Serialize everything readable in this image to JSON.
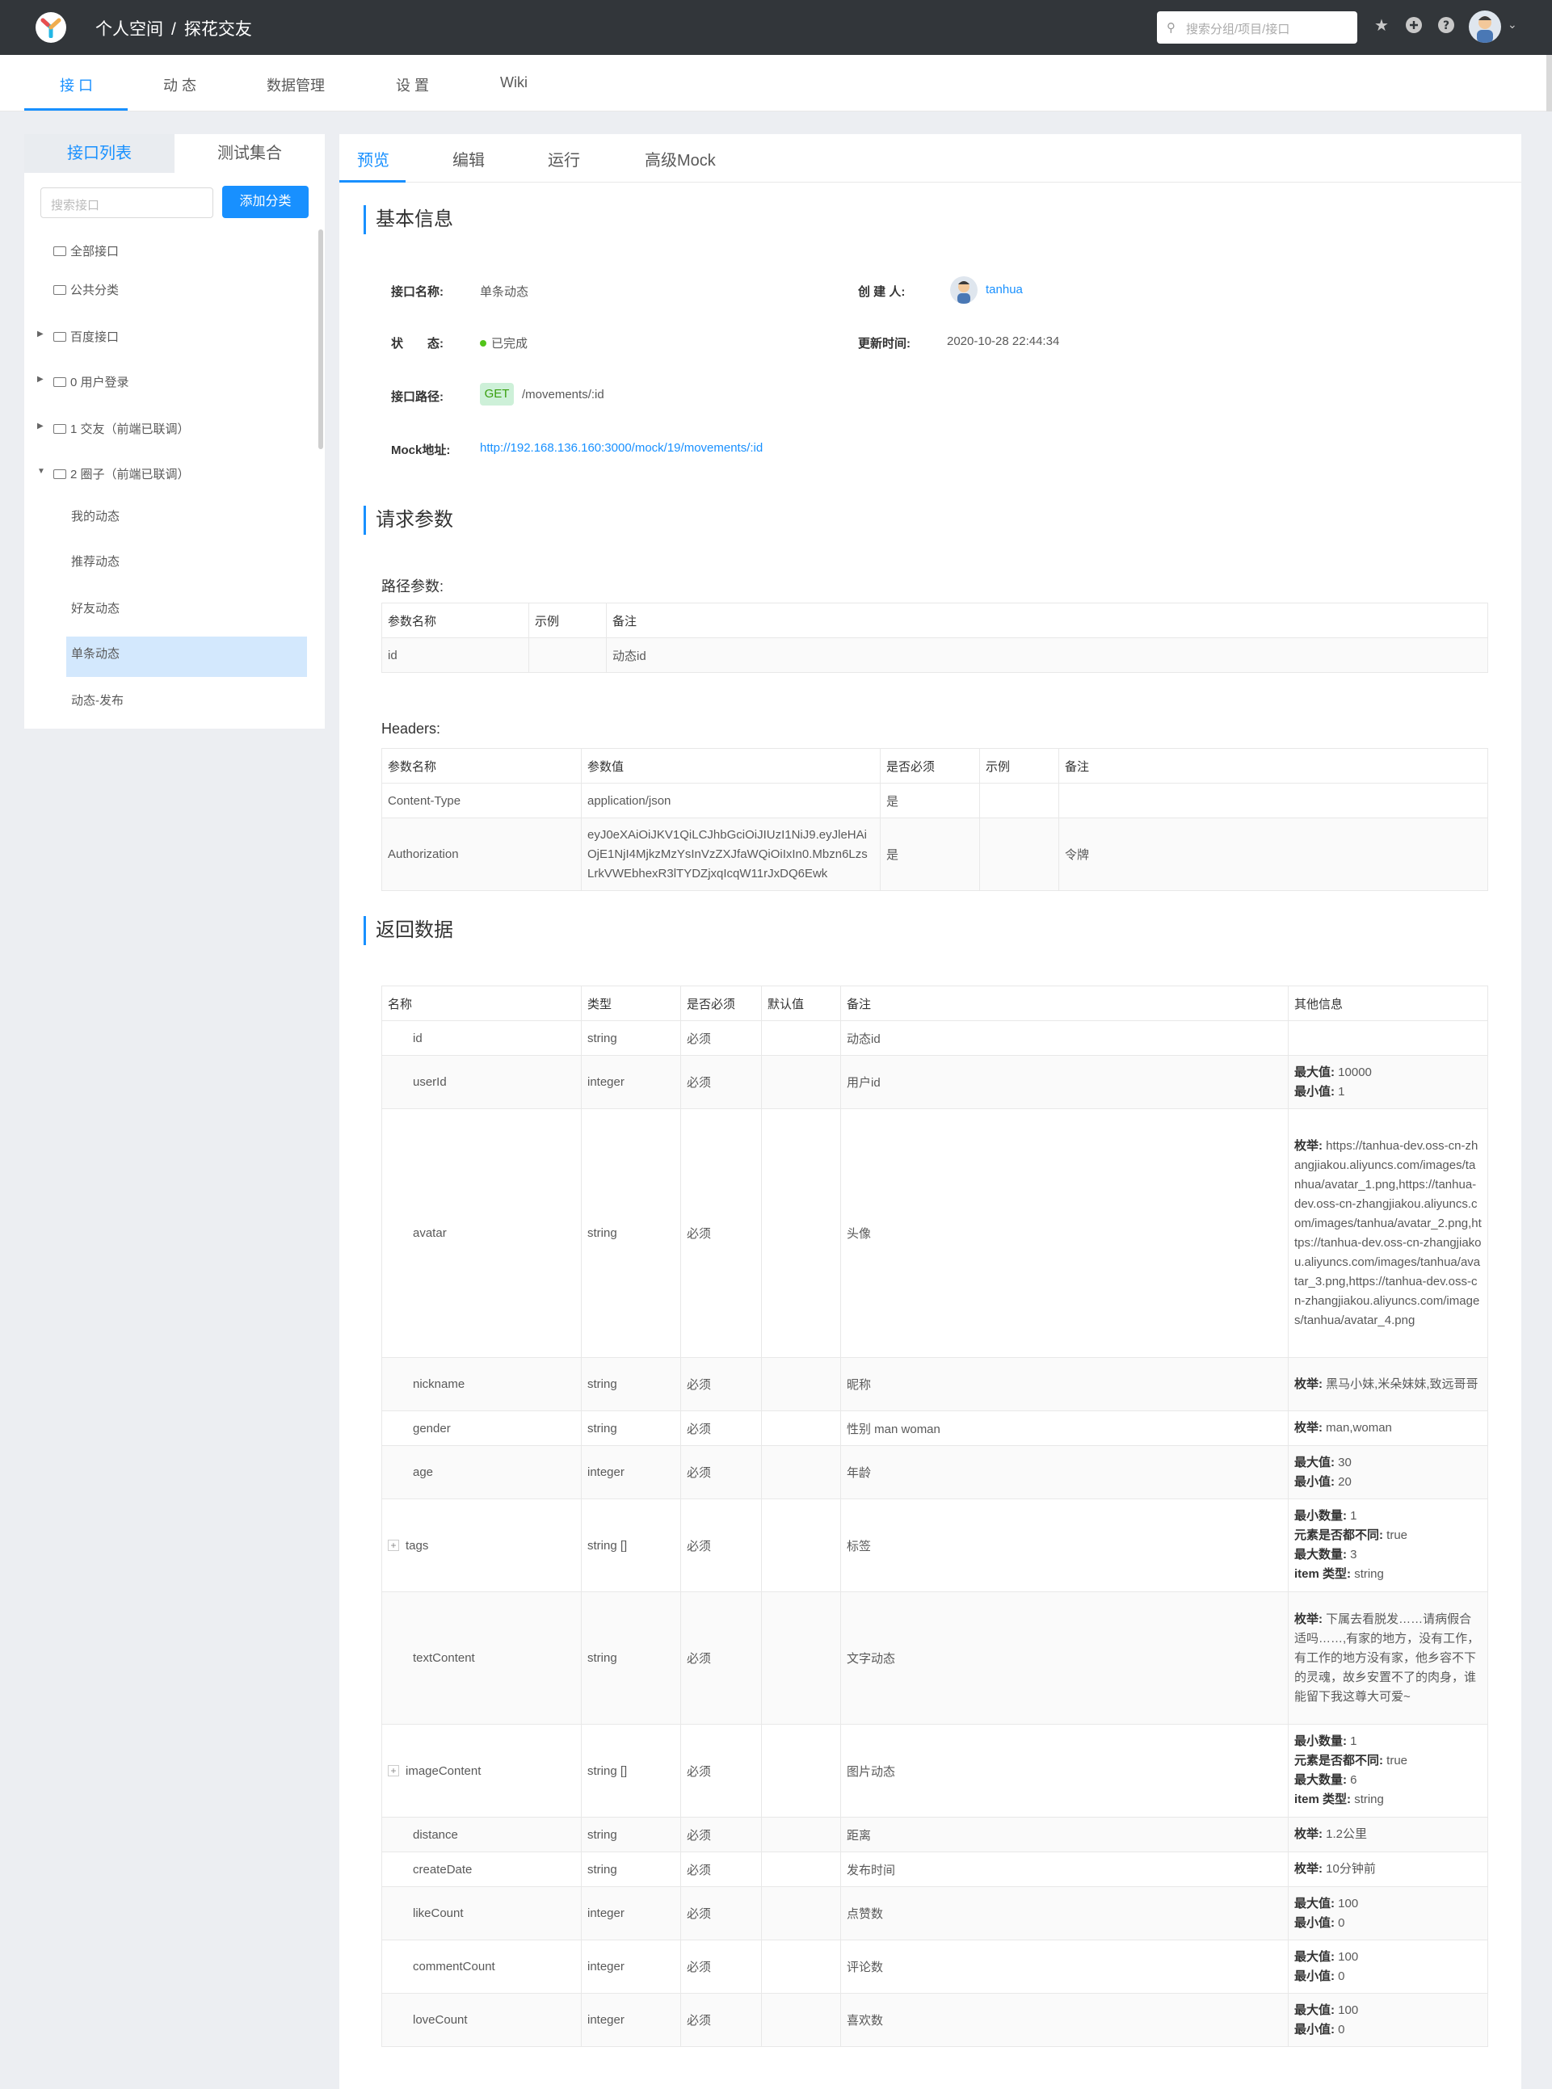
{
  "header": {
    "crumb_space": "个人空间",
    "crumb_sep": "/",
    "crumb_project": "探花交友",
    "search_placeholder": "搜索分组/项目/接口"
  },
  "subnav": [
    "接 口",
    "动 态",
    "数据管理",
    "设 置",
    "Wiki"
  ],
  "left": {
    "tab_list": "接口列表",
    "tab_test": "测试集合",
    "search_placeholder": "搜索接口",
    "add_button": "添加分类",
    "nodes": [
      "全部接口",
      "公共分类",
      "百度接口",
      "0 用户登录",
      "1 交友（前端已联调）",
      "2 圈子（前端已联调）"
    ],
    "children": [
      "我的动态",
      "推荐动态",
      "好友动态",
      "单条动态",
      "动态-发布"
    ]
  },
  "tabs": [
    "预览",
    "编辑",
    "运行",
    "高级Mock"
  ],
  "basic": {
    "title": "基本信息",
    "name_label": "接口名称:",
    "name_value": "单条动态",
    "creator_label": "创 建 人:",
    "creator_value": "tanhua",
    "status_label": "状　　态:",
    "status_value": "已完成",
    "updated_label": "更新时间:",
    "updated_value": "2020-10-28 22:44:34",
    "path_label": "接口路径:",
    "method": "GET",
    "path_value": "/movements/:id",
    "mock_label": "Mock地址:",
    "mock_value": "http://192.168.136.160:3000/mock/19/movements/:id"
  },
  "request": {
    "title": "请求参数",
    "path_params_label": "路径参数:",
    "path_headers": [
      "参数名称",
      "示例",
      "备注"
    ],
    "path_rows": [
      [
        "id",
        "",
        "动态id"
      ]
    ],
    "headers_label": "Headers:",
    "header_cols": [
      "参数名称",
      "参数值",
      "是否必须",
      "示例",
      "备注"
    ],
    "header_rows": [
      [
        "Content-Type",
        "application/json",
        "是",
        "",
        ""
      ],
      [
        "Authorization",
        "eyJ0eXAiOiJKV1QiLCJhbGciOiJIUzI1NiJ9.eyJleHAiOjE1NjI4MjkzMzYsInVzZXJfaWQiOiIxIn0.Mbzn6LzsLrkVWEbhexR3lTYDZjxqIcqW11rJxDQ6Ewk",
        "是",
        "",
        "令牌"
      ]
    ]
  },
  "response": {
    "title": "返回数据",
    "cols": [
      "名称",
      "类型",
      "是否必须",
      "默认值",
      "备注",
      "其他信息"
    ],
    "rows": [
      {
        "name": "id",
        "type": "string",
        "req": "必须",
        "def": "",
        "note": "动态id",
        "other": []
      },
      {
        "name": "userId",
        "type": "integer",
        "req": "必须",
        "def": "",
        "note": "用户id",
        "other": [
          [
            "最大值:",
            "10000"
          ],
          [
            "最小值:",
            "1"
          ]
        ]
      },
      {
        "name": "avatar",
        "type": "string",
        "req": "必须",
        "def": "",
        "note": "头像",
        "other": [
          [
            "枚举:",
            "https://tanhua-dev.oss-cn-zhangjiakou.aliyuncs.com/images/tanhua/avatar_1.png,https://tanhua-dev.oss-cn-zhangjiakou.aliyuncs.com/images/tanhua/avatar_2.png,https://tanhua-dev.oss-cn-zhangjiakou.aliyuncs.com/images/tanhua/avatar_3.png,https://tanhua-dev.oss-cn-zhangjiakou.aliyuncs.com/images/tanhua/avatar_4.png"
          ]
        ]
      },
      {
        "name": "nickname",
        "type": "string",
        "req": "必须",
        "def": "",
        "note": "昵称",
        "other": [
          [
            "枚举:",
            "黑马小妹,米朵妹妹,致远哥哥"
          ]
        ]
      },
      {
        "name": "gender",
        "type": "string",
        "req": "必须",
        "def": "",
        "note": "性别 man woman",
        "other": [
          [
            "枚举:",
            "man,woman"
          ]
        ]
      },
      {
        "name": "age",
        "type": "integer",
        "req": "必须",
        "def": "",
        "note": "年龄",
        "other": [
          [
            "最大值:",
            "30"
          ],
          [
            "最小值:",
            "20"
          ]
        ]
      },
      {
        "name": "tags",
        "type": "string []",
        "req": "必须",
        "def": "",
        "note": "标签",
        "expand": "+",
        "other": [
          [
            "最小数量:",
            "1"
          ],
          [
            "元素是否都不同:",
            "true"
          ],
          [
            "最大数量:",
            "3"
          ],
          [
            "item 类型:",
            "string"
          ]
        ]
      },
      {
        "name": "textContent",
        "type": "string",
        "req": "必须",
        "def": "",
        "note": "文字动态",
        "other": [
          [
            "枚举:",
            "下属去看脱发……请病假合适吗……,有家的地方，没有工作，有工作的地方没有家，他乡容不下的灵魂，故乡安置不了的肉身，谁能留下我这尊大可爱~"
          ]
        ]
      },
      {
        "name": "imageContent",
        "type": "string []",
        "req": "必须",
        "def": "",
        "note": "图片动态",
        "expand": "+",
        "other": [
          [
            "最小数量:",
            "1"
          ],
          [
            "元素是否都不同:",
            "true"
          ],
          [
            "最大数量:",
            "6"
          ],
          [
            "item 类型:",
            "string"
          ]
        ]
      },
      {
        "name": "distance",
        "type": "string",
        "req": "必须",
        "def": "",
        "note": "距离",
        "other": [
          [
            "枚举:",
            "1.2公里"
          ]
        ]
      },
      {
        "name": "createDate",
        "type": "string",
        "req": "必须",
        "def": "",
        "note": "发布时间",
        "other": [
          [
            "枚举:",
            "10分钟前"
          ]
        ]
      },
      {
        "name": "likeCount",
        "type": "integer",
        "req": "必须",
        "def": "",
        "note": "点赞数",
        "other": [
          [
            "最大值:",
            "100"
          ],
          [
            "最小值:",
            "0"
          ]
        ]
      },
      {
        "name": "commentCount",
        "type": "integer",
        "req": "必须",
        "def": "",
        "note": "评论数",
        "other": [
          [
            "最大值:",
            "100"
          ],
          [
            "最小值:",
            "0"
          ]
        ]
      },
      {
        "name": "loveCount",
        "type": "integer",
        "req": "必须",
        "def": "",
        "note": "喜欢数",
        "other": [
          [
            "最大值:",
            "100"
          ],
          [
            "最小值:",
            "0"
          ]
        ]
      }
    ]
  }
}
